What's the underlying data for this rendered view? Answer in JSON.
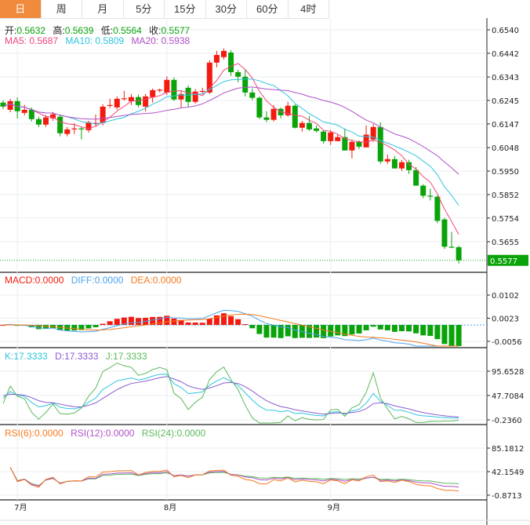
{
  "tabs": [
    {
      "label": "日",
      "active": true
    },
    {
      "label": "周"
    },
    {
      "label": "月"
    },
    {
      "label": "5分"
    },
    {
      "label": "15分"
    },
    {
      "label": "30分"
    },
    {
      "label": "60分"
    },
    {
      "label": "4时"
    }
  ],
  "ohlc_legend": {
    "open_label": "开:",
    "open": "0.5632",
    "high_label": "高:",
    "high": "0.5639",
    "low_label": "低:",
    "low": "0.5564",
    "close_label": "收:",
    "close": "0.5577"
  },
  "ma_legend": {
    "ma5": "MA5: 0.5687",
    "ma10": "MA10: 0.5809",
    "ma20": "MA20: 0.5938"
  },
  "macd_legend": {
    "macd": "MACD:0.0000",
    "diff": "DIFF:0.0000",
    "dea": "DEA:0.0000"
  },
  "kdj_legend": {
    "k": "K:17.3333",
    "d": "D:17.3333",
    "j": "J:17.3333"
  },
  "rsi_legend": {
    "rsi6": "RSI(6):0.0000",
    "rsi12": "RSI(12):0.0000",
    "rsi24": "RSI(24):0.0000"
  },
  "colors": {
    "up": "#f31b10",
    "down": "#0aa30a",
    "ma5": "#f0477a",
    "ma10": "#2fc4e0",
    "ma20": "#b050c8",
    "diff": "#4aa3f0",
    "dea": "#f57a1e",
    "k": "#2fc4e0",
    "d": "#8a5ad0",
    "j": "#5cb85c",
    "rsi6": "#f57a1e",
    "rsi12": "#b050c8",
    "rsi24": "#5cb85c",
    "tab_active": "#f08a3c"
  },
  "chart_data": {
    "type": "candlestick",
    "price_axis": {
      "ticks": [
        "0.6540",
        "0.6442",
        "0.6343",
        "0.6245",
        "0.6147",
        "0.6048",
        "0.5950",
        "0.5852",
        "0.5754",
        "0.5655"
      ],
      "range": [
        0.5557,
        0.66
      ]
    },
    "last_price": "0.5577",
    "macd_axis": {
      "ticks": [
        "0.0102",
        "0.0023",
        "-0.0056"
      ]
    },
    "kdj_axis": {
      "ticks": [
        "95.6528",
        "47.7084",
        "-0.2360"
      ]
    },
    "rsi_axis": {
      "ticks": [
        "85.1812",
        "42.1549",
        "-0.8713"
      ]
    },
    "x_labels": [
      {
        "label": "7月",
        "index": 2
      },
      {
        "label": "8月",
        "index": 23
      },
      {
        "label": "9月",
        "index": 46
      }
    ],
    "ohlc": [
      [
        0.6236,
        0.6246,
        0.6209,
        0.6219
      ],
      [
        0.6206,
        0.6252,
        0.6196,
        0.6242
      ],
      [
        0.6242,
        0.6258,
        0.617,
        0.62
      ],
      [
        0.6193,
        0.6226,
        0.6183,
        0.6206
      ],
      [
        0.6206,
        0.6216,
        0.6157,
        0.6167
      ],
      [
        0.6167,
        0.6177,
        0.6134,
        0.6144
      ],
      [
        0.6144,
        0.6184,
        0.6134,
        0.6174
      ],
      [
        0.617,
        0.6197,
        0.616,
        0.6187
      ],
      [
        0.6177,
        0.6187,
        0.6095,
        0.6108
      ],
      [
        0.6105,
        0.6134,
        0.6095,
        0.6124
      ],
      [
        0.6124,
        0.615,
        0.6105,
        0.6128
      ],
      [
        0.6128,
        0.6134,
        0.6082,
        0.6126
      ],
      [
        0.6121,
        0.616,
        0.6111,
        0.6154
      ],
      [
        0.6147,
        0.6186,
        0.6137,
        0.6151
      ],
      [
        0.6151,
        0.6229,
        0.6141,
        0.6219
      ],
      [
        0.6223,
        0.6252,
        0.6213,
        0.6226
      ],
      [
        0.6216,
        0.6262,
        0.6206,
        0.6252
      ],
      [
        0.6252,
        0.6285,
        0.6245,
        0.6254
      ],
      [
        0.6242,
        0.6272,
        0.6226,
        0.6259
      ],
      [
        0.6259,
        0.6269,
        0.6216,
        0.6226
      ],
      [
        0.6219,
        0.6272,
        0.62,
        0.6262
      ],
      [
        0.6259,
        0.6295,
        0.6236,
        0.6288
      ],
      [
        0.6288,
        0.6295,
        0.6278,
        0.629
      ],
      [
        0.6278,
        0.6346,
        0.6268,
        0.6331
      ],
      [
        0.6331,
        0.6341,
        0.6242,
        0.6249
      ],
      [
        0.6249,
        0.6285,
        0.6216,
        0.6272
      ],
      [
        0.6298,
        0.6308,
        0.6219,
        0.6239
      ],
      [
        0.6239,
        0.6292,
        0.6232,
        0.6282
      ],
      [
        0.6282,
        0.6298,
        0.6272,
        0.6285
      ],
      [
        0.6278,
        0.6413,
        0.6272,
        0.6403
      ],
      [
        0.6403,
        0.6452,
        0.6383,
        0.6435
      ],
      [
        0.6426,
        0.6462,
        0.6416,
        0.6452
      ],
      [
        0.6445,
        0.6455,
        0.6347,
        0.6363
      ],
      [
        0.6363,
        0.6373,
        0.6321,
        0.6344
      ],
      [
        0.6344,
        0.6373,
        0.6262,
        0.6278
      ],
      [
        0.6278,
        0.6295,
        0.6246,
        0.6256
      ],
      [
        0.6256,
        0.6262,
        0.6167,
        0.6174
      ],
      [
        0.6174,
        0.62,
        0.6154,
        0.6164
      ],
      [
        0.6164,
        0.6226,
        0.6157,
        0.621
      ],
      [
        0.621,
        0.6216,
        0.617,
        0.6183
      ],
      [
        0.6183,
        0.6239,
        0.6177,
        0.6223
      ],
      [
        0.6223,
        0.6229,
        0.6128,
        0.6131
      ],
      [
        0.6131,
        0.616,
        0.6115,
        0.6151
      ],
      [
        0.6151,
        0.618,
        0.6118,
        0.6124
      ],
      [
        0.6128,
        0.6141,
        0.6111,
        0.6118
      ],
      [
        0.6115,
        0.6121,
        0.6065,
        0.6075
      ],
      [
        0.6075,
        0.6121,
        0.6059,
        0.6111
      ],
      [
        0.6075,
        0.6105,
        0.6075,
        0.6092
      ],
      [
        0.6092,
        0.6128,
        0.6036,
        0.6036
      ],
      [
        0.6036,
        0.6082,
        0.6003,
        0.6072
      ],
      [
        0.6072,
        0.6078,
        0.6042,
        0.6052
      ],
      [
        0.6049,
        0.6141,
        0.6049,
        0.6102
      ],
      [
        0.6082,
        0.6147,
        0.6072,
        0.6134
      ],
      [
        0.6134,
        0.6154,
        0.598,
        0.599
      ],
      [
        0.599,
        0.6019,
        0.598,
        0.6
      ],
      [
        0.6,
        0.6013,
        0.5961,
        0.5961
      ],
      [
        0.5961,
        0.5997,
        0.5951,
        0.5987
      ],
      [
        0.5987,
        0.5997,
        0.5938,
        0.5954
      ],
      [
        0.5954,
        0.5967,
        0.5889,
        0.5889
      ],
      [
        0.5889,
        0.5895,
        0.5837,
        0.5847
      ],
      [
        0.5847,
        0.5876,
        0.5827,
        0.5843
      ],
      [
        0.5843,
        0.5847,
        0.5732,
        0.5742
      ],
      [
        0.5748,
        0.5755,
        0.5625,
        0.5634
      ],
      [
        0.5634,
        0.5696,
        0.5628,
        0.5631
      ],
      [
        0.5632,
        0.5639,
        0.5564,
        0.5577
      ]
    ]
  }
}
